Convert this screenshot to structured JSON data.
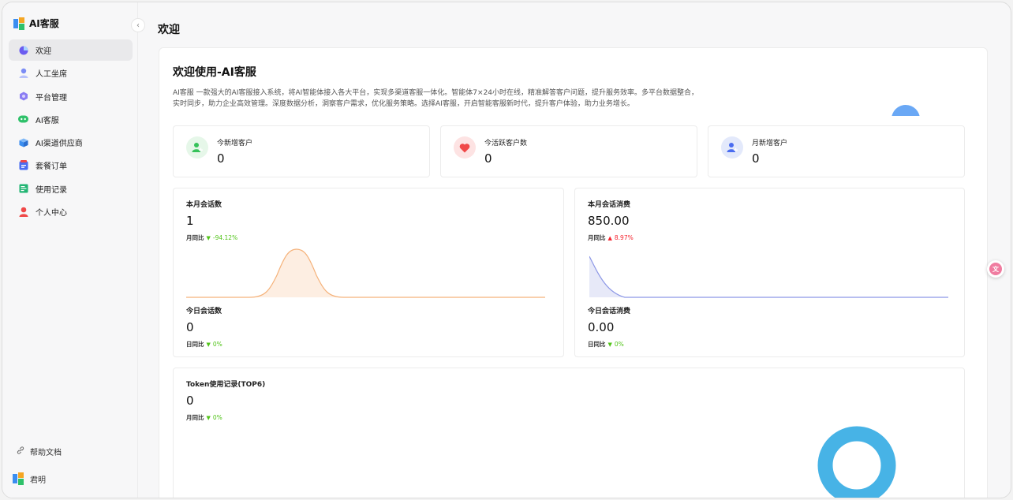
{
  "app": {
    "name": "AI客服"
  },
  "sidebar": {
    "items": [
      {
        "label": "欢迎",
        "icon": "pie-chart-icon",
        "color": "#6b5cf0",
        "active": true
      },
      {
        "label": "人工坐席",
        "icon": "user-icon",
        "color": "#7b8cf5"
      },
      {
        "label": "平台管理",
        "icon": "hexagon-icon",
        "color": "#8a7cf3"
      },
      {
        "label": "AI客服",
        "icon": "robot-icon",
        "color": "#2fc16a"
      },
      {
        "label": "AI渠道供应商",
        "icon": "cube-icon",
        "color": "#3b8ef0"
      },
      {
        "label": "套餐订单",
        "icon": "order-icon",
        "color": "#4a6cf0"
      },
      {
        "label": "使用记录",
        "icon": "record-icon",
        "color": "#22b573"
      },
      {
        "label": "个人中心",
        "icon": "person-icon",
        "color": "#f04848"
      }
    ],
    "help_label": "帮助文档",
    "user_name": "君明"
  },
  "page": {
    "title": "欢迎",
    "welcome_title": "欢迎使用-AI客服",
    "welcome_desc": "AI客服 一款强大的AI客服接入系统，将AI智能体接入各大平台，实现多渠道客服一体化。智能体7×24小时在线，精准解答客户问题，提升服务效率。多平台数据整合，实时同步，助力企业高效管理。深度数据分析，洞察客户需求，优化服务策略。选择AI客服，开启智能客服新时代，提升客户体验，助力业务增长。"
  },
  "stats": [
    {
      "label": "今新增客户",
      "value": "0",
      "icon": "add-user-icon",
      "bg": "#e6f7e9",
      "fg": "#36c25a"
    },
    {
      "label": "今活跃客户数",
      "value": "0",
      "icon": "heart-icon",
      "bg": "#fde3e3",
      "fg": "#f04848"
    },
    {
      "label": "月新增客户",
      "value": "0",
      "icon": "add-user-icon",
      "bg": "#e3e9fb",
      "fg": "#4a6cf0"
    }
  ],
  "sessions": {
    "month_label": "本月会话数",
    "month_value": "1",
    "month_cmp_label": "月同比",
    "month_cmp_value": "-94.12%",
    "today_label": "今日会话数",
    "today_value": "0",
    "today_cmp_label": "日同比",
    "today_cmp_value": "0%"
  },
  "consumption": {
    "month_label": "本月会话消费",
    "month_value": "850.00",
    "month_cmp_label": "月同比",
    "month_cmp_value": "8.97%",
    "today_label": "今日会话消费",
    "today_value": "0.00",
    "today_cmp_label": "日同比",
    "today_cmp_value": "0%"
  },
  "token": {
    "title": "Token使用记录(TOP6)",
    "value": "0",
    "cmp_label": "月同比",
    "cmp_value": "0%"
  },
  "colors": {
    "session_line": "#f5b27a",
    "session_fill": "#fdeee2",
    "consume_line": "#8c97e6",
    "consume_fill": "#e7e9f8",
    "donut": "#47b3e6"
  },
  "float_button_icon": "translate-icon"
}
